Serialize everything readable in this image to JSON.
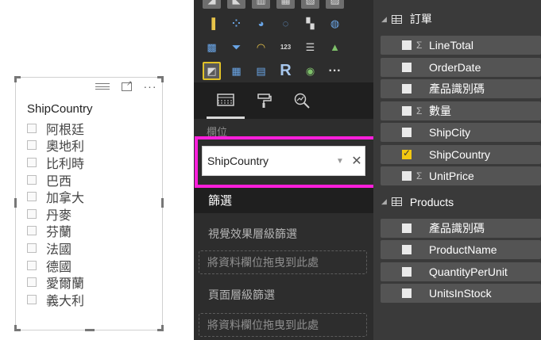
{
  "slicer": {
    "title": "ShipCountry",
    "items": [
      "阿根廷",
      "奧地利",
      "比利時",
      "巴西",
      "加拿大",
      "丹麥",
      "芬蘭",
      "法國",
      "德國",
      "愛爾蘭",
      "義大利"
    ],
    "toolbar_icons": [
      "drag-handle-icon",
      "focus-mode-icon",
      "more-options-icon"
    ]
  },
  "visualizations": {
    "icons": [
      {
        "name": "area-chart-icon",
        "glyph": "◢"
      },
      {
        "name": "stacked-area-icon",
        "glyph": "◣"
      },
      {
        "name": "ribbon-chart-icon",
        "glyph": "▥"
      },
      {
        "name": "waterfall-icon",
        "glyph": "▦"
      },
      {
        "name": "scatter-chart-icon",
        "glyph": "▧"
      },
      {
        "name": "pie-chart-top-icon",
        "glyph": "▨"
      },
      {
        "name": "waterfall-chart-icon",
        "glyph": "▐"
      },
      {
        "name": "scatter-icon",
        "glyph": "⁘"
      },
      {
        "name": "pie-chart-icon",
        "glyph": "◕"
      },
      {
        "name": "donut-chart-icon",
        "glyph": "◌"
      },
      {
        "name": "treemap-icon",
        "glyph": "▚"
      },
      {
        "name": "map-icon",
        "glyph": "◍"
      },
      {
        "name": "filled-map-icon",
        "glyph": "▩"
      },
      {
        "name": "funnel-icon",
        "glyph": "⏷"
      },
      {
        "name": "gauge-icon",
        "glyph": "◠"
      },
      {
        "name": "card-icon",
        "glyph": "123"
      },
      {
        "name": "multi-row-card-icon",
        "glyph": "☰"
      },
      {
        "name": "kpi-icon",
        "glyph": "▲"
      },
      {
        "name": "slicer-icon",
        "glyph": "◩"
      },
      {
        "name": "table-icon",
        "glyph": "▦"
      },
      {
        "name": "matrix-icon",
        "glyph": "▤"
      },
      {
        "name": "r-script-icon",
        "glyph": "R"
      },
      {
        "name": "globe-icon",
        "glyph": "◉"
      },
      {
        "name": "more-visuals-icon",
        "glyph": "···"
      }
    ],
    "tabs": [
      "fields-tab-icon",
      "format-tab-icon",
      "analytics-tab-icon"
    ],
    "fields_label": "欄位",
    "field_well_value": "ShipCountry",
    "filters": {
      "header": "篩選",
      "visual_level": "視覺效果層級篩選",
      "drop_here": "將資料欄位拖曳到此處",
      "page_level": "頁面層級篩選",
      "drop_here_2": "將資料欄位拖曳到此處"
    }
  },
  "fields": {
    "tables": [
      {
        "name": "訂單",
        "fields": [
          {
            "label": "LineTotal",
            "sigma": true,
            "checked": false
          },
          {
            "label": "OrderDate",
            "sigma": false,
            "checked": false
          },
          {
            "label": "產品識別碼",
            "sigma": false,
            "checked": false
          },
          {
            "label": "數量",
            "sigma": true,
            "checked": false
          },
          {
            "label": "ShipCity",
            "sigma": false,
            "checked": false
          },
          {
            "label": "ShipCountry",
            "sigma": false,
            "checked": true
          },
          {
            "label": "UnitPrice",
            "sigma": true,
            "checked": false
          }
        ]
      },
      {
        "name": "Products",
        "fields": [
          {
            "label": "產品識別碼",
            "sigma": false,
            "checked": false
          },
          {
            "label": "ProductName",
            "sigma": false,
            "checked": false
          },
          {
            "label": "QuantityPerUnit",
            "sigma": false,
            "checked": false
          },
          {
            "label": "UnitsInStock",
            "sigma": false,
            "checked": false
          }
        ]
      }
    ]
  },
  "colors": {
    "highlight": "#ff1fdb",
    "checked": "#f2c811",
    "pane_dark": "#2d2d2d",
    "fields_bg": "#3a3a3a"
  }
}
